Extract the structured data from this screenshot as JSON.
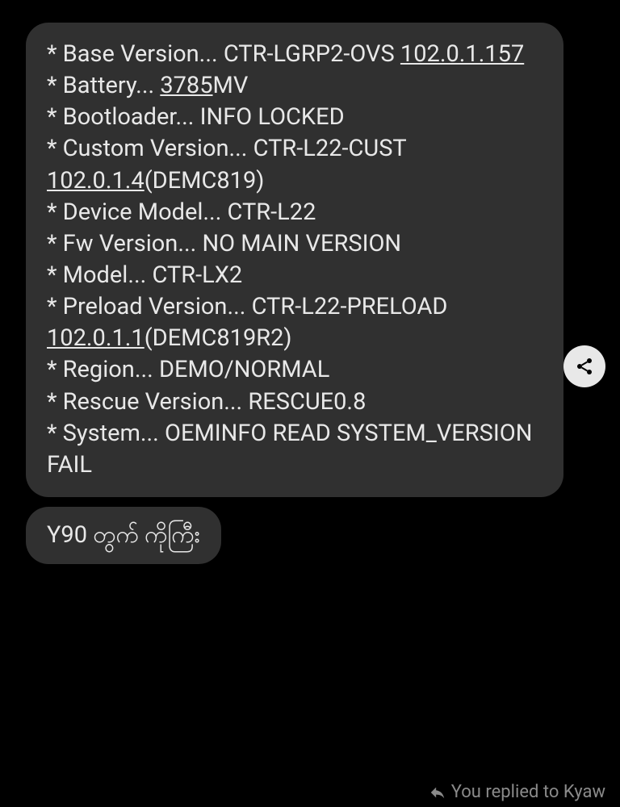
{
  "message1": {
    "line1_a": "* Base Version... CTR-LGRP2-OVS ",
    "line1_b": "102.0.1.157",
    "line2_a": " * Battery... ",
    "line2_b": "3785",
    "line2_c": "MV",
    "line3": " * Bootloader... INFO LOCKED",
    "line4": " * Custom Version... CTR-L22-CUST ",
    "line4_b": "102.0.1.4",
    "line4_c": "(DEMC819)",
    "line5": " * Device Model... CTR-L22",
    "line6": " * Fw Version... NO MAIN VERSION",
    "line7": " * Model... CTR-LX2",
    "line8": " * Preload Version... CTR-L22-PRELOAD ",
    "line8_b": "102.0.1.1",
    "line8_c": "(DEMC819R2)",
    "line9": " * Region... DEMO/NORMAL",
    "line10": " * Rescue Version... RESCUE0.8",
    "line11": " * System... OEMINFO READ SYSTEM_VERSION FAIL"
  },
  "message2": "Y90 တွက် ကိုကြီး",
  "replyIndicator": "You replied to Kyaw"
}
